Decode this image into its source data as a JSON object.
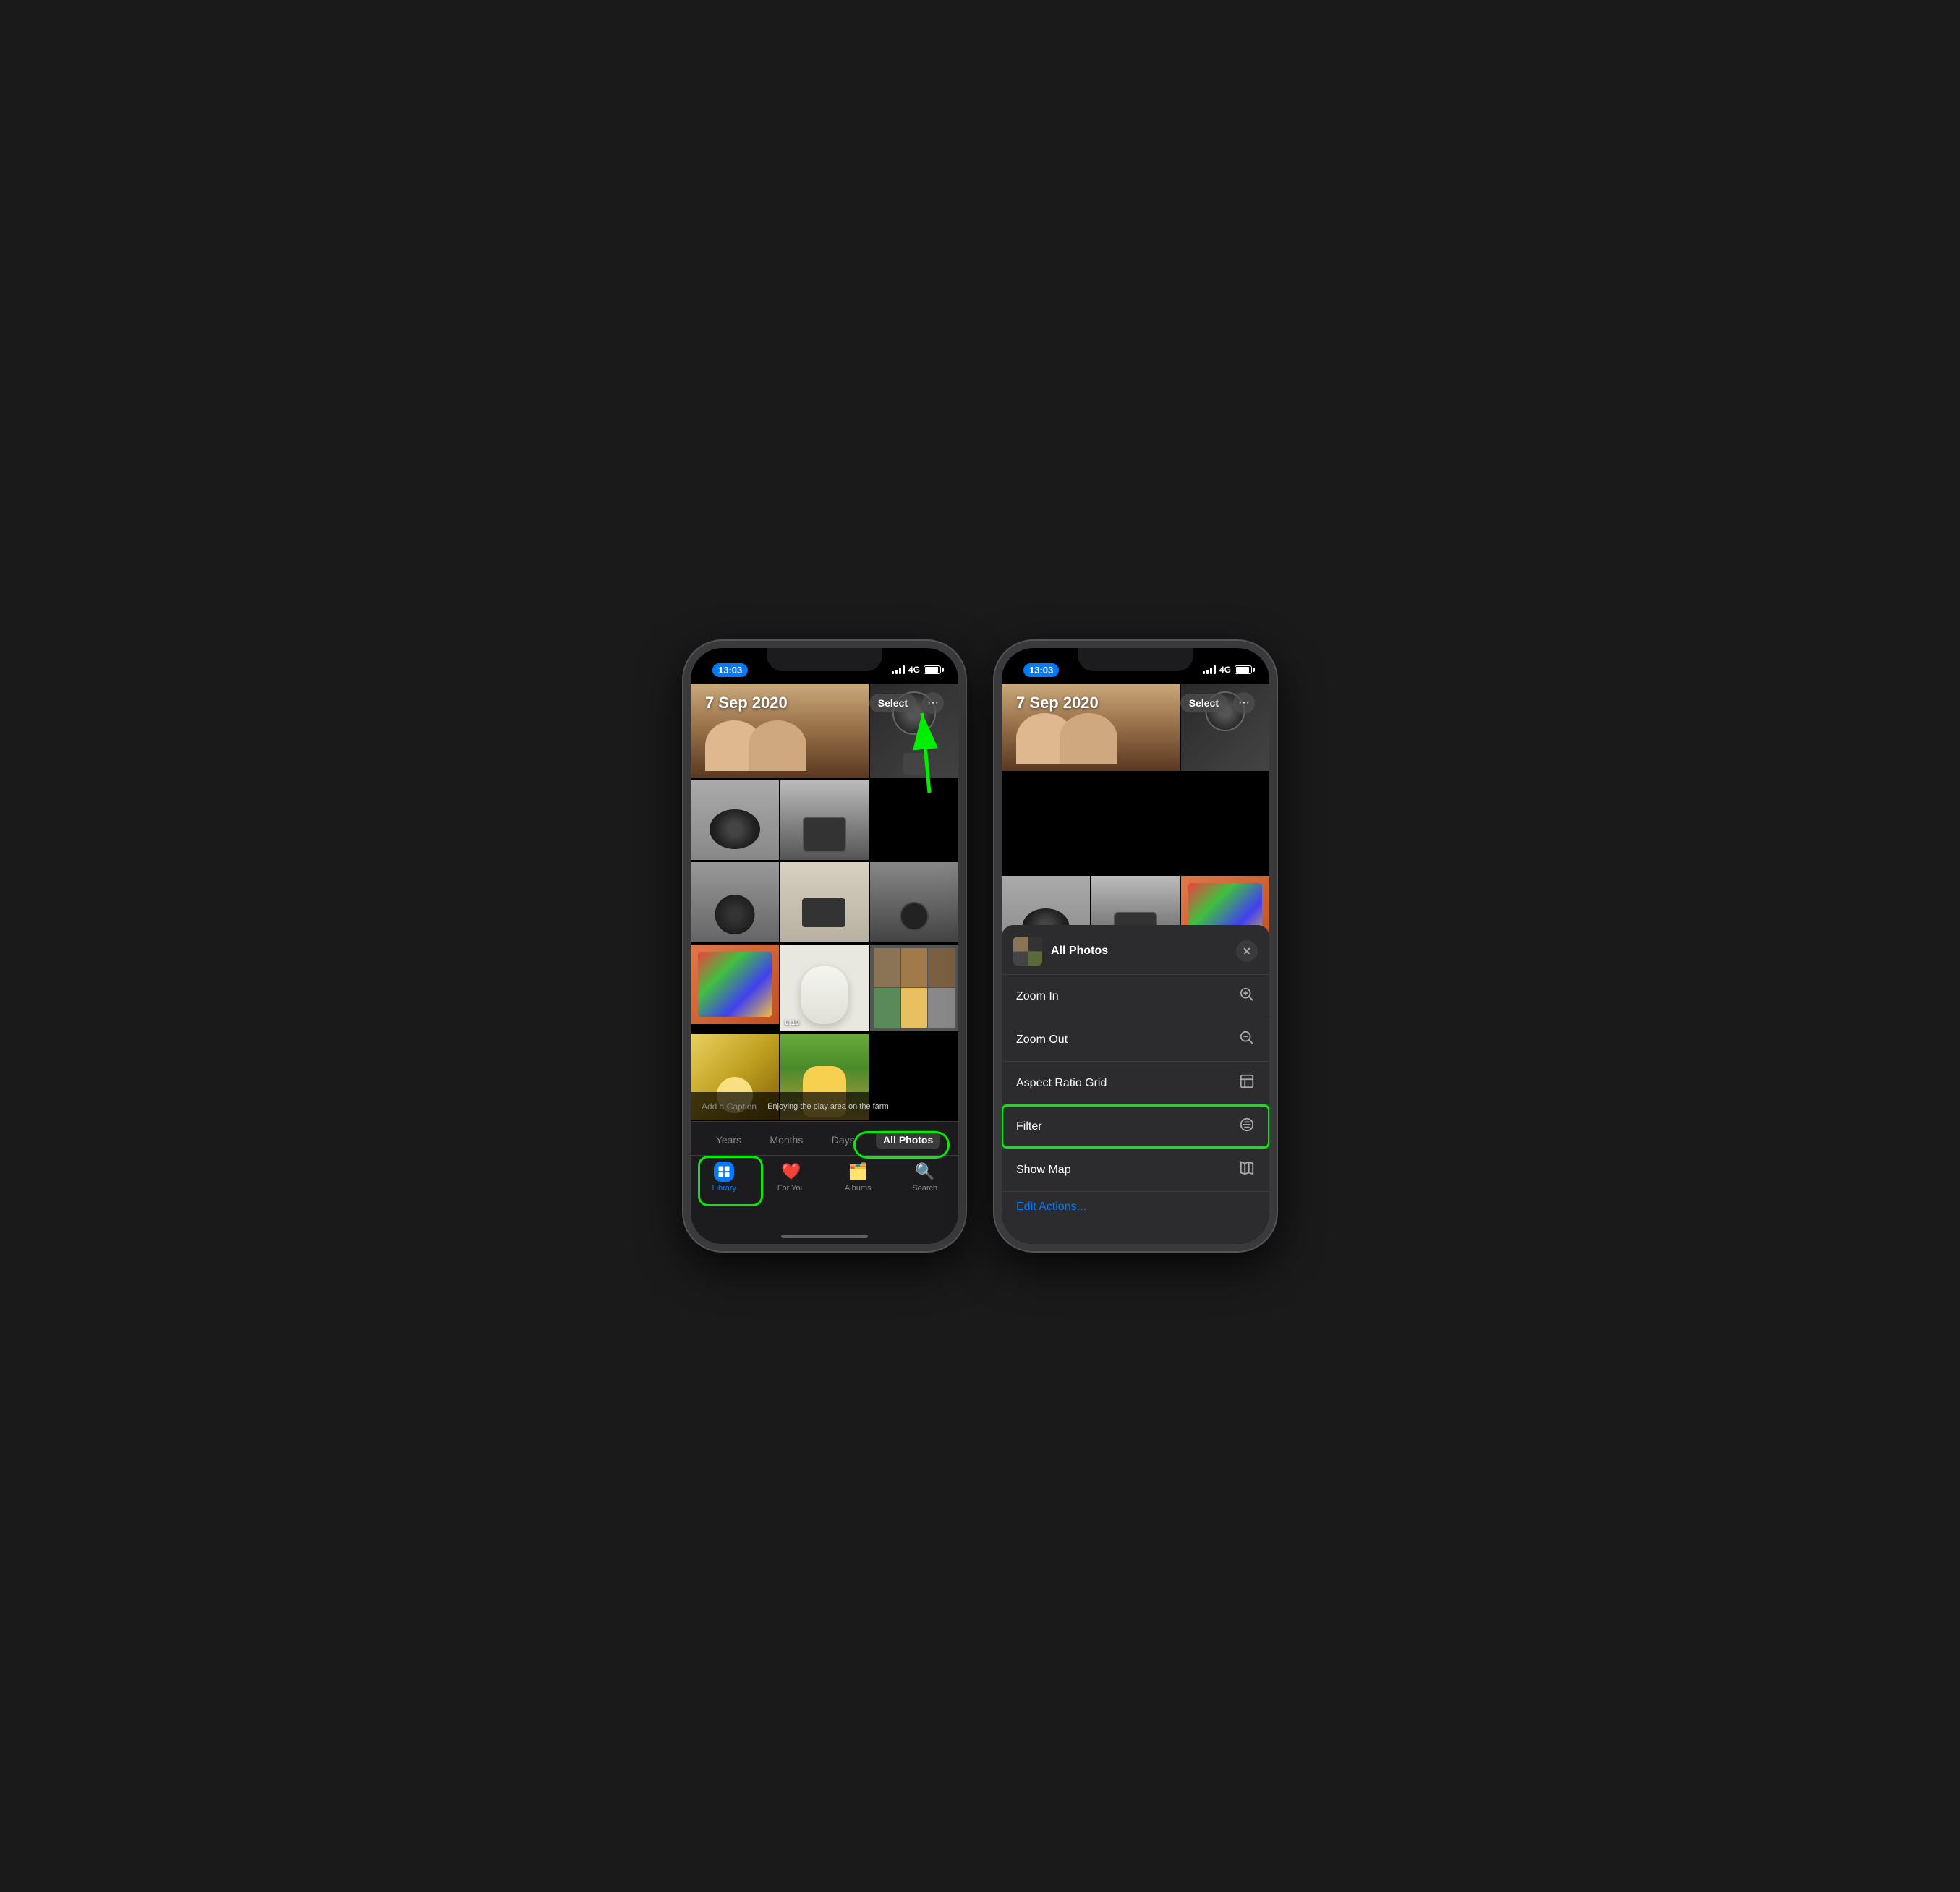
{
  "left_phone": {
    "status": {
      "time": "13:03",
      "network": "4G"
    },
    "header": {
      "date": "7 Sep 2020",
      "select_label": "Select",
      "dots_label": "···"
    },
    "filter_tabs": {
      "years": "Years",
      "months": "Months",
      "days": "Days",
      "all_photos": "All Photos"
    },
    "tab_bar": {
      "library": "Library",
      "for_you": "For You",
      "albums": "Albums",
      "search": "Search"
    },
    "photo_caption": {
      "add_caption": "Add a Caption",
      "caption_text": "Enjoying the play area on the farm"
    },
    "video_badge": "0:10"
  },
  "right_phone": {
    "status": {
      "time": "13:03",
      "network": "4G"
    },
    "header": {
      "date": "7 Sep 2020",
      "select_label": "Select",
      "dots_label": "···"
    },
    "context_menu": {
      "title": "All Photos",
      "close_label": "✕",
      "items": [
        {
          "label": "Zoom In",
          "icon": "⊕"
        },
        {
          "label": "Zoom Out",
          "icon": "⊖"
        },
        {
          "label": "Aspect Ratio Grid",
          "icon": "⊡"
        },
        {
          "label": "Filter",
          "icon": "≡"
        },
        {
          "label": "Show Map",
          "icon": "🗺"
        }
      ],
      "edit_actions": "Edit Actions..."
    }
  }
}
